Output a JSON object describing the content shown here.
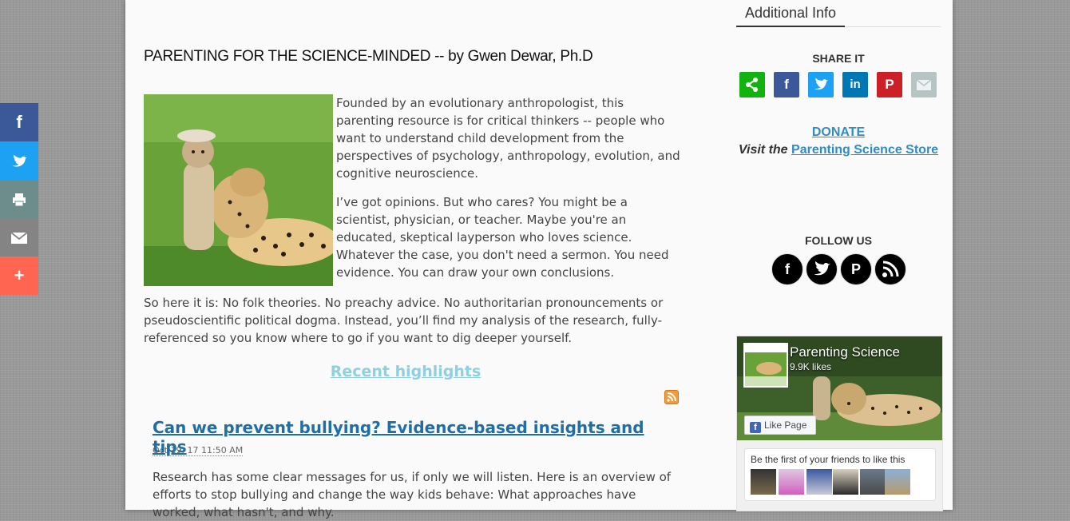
{
  "article": {
    "heading": "PARENTING FOR THE SCIENCE-MINDED -- by Gwen Dewar, Ph.D",
    "intro_p1": "Founded by an evolutionary anthropologist, this parenting resource is for critical thinkers -- people who want to understand child development from the perspectives of psychology, anthropology, evolution, and cognitive neuroscience.",
    "intro_p2": "I’ve got opinions. But who cares? You might be a scientist, physician, or teacher. Maybe you're an educated, skeptical layperson who loves science. Whatever the case, you don't need a sermon. You need evidence. You can draw your own conclusions.",
    "intro_p3": "So here it is: No folk theories. No preachy advice. No authoritarian pronouncements or pseudoscientific political dogma. Instead, you’ll find my analysis of the research, fully-referenced so you know where to go if you want to dig deeper yourself.",
    "recent_label": "Recent highlights"
  },
  "post": {
    "title": "Can we prevent bullying? Evidence-based insights and tips",
    "date": "Oct 19, 17 11:50 AM",
    "excerpt": "Research has some clear messages for us, if only we will listen. Here is an overview of efforts to stop bullying and change the way kids behave: What approaches have worked, what hasn't, and why."
  },
  "sidebar": {
    "tab_label": "Additional Info",
    "share_title": "SHARE IT",
    "share_buttons": [
      {
        "icon": "share-icon",
        "color": "#11b311"
      },
      {
        "icon": "facebook-icon",
        "color": "#3b5998"
      },
      {
        "icon": "twitter-icon",
        "color": "#1da1f2"
      },
      {
        "icon": "linkedin-icon",
        "color": "#0077b5"
      },
      {
        "icon": "pinterest-icon",
        "color": "#cb2027"
      },
      {
        "icon": "email-icon",
        "color": "#b7c4c4"
      }
    ],
    "donate_label": "DONATE",
    "visit_label": "Visit the",
    "store_label": "Parenting Science Store",
    "follow_title": "FOLLOW US",
    "follow_icons": [
      "facebook-icon",
      "twitter-icon",
      "pinterest-icon",
      "rss-icon"
    ]
  },
  "fb_widget": {
    "page_name": "Parenting Science",
    "likes": "9.9K likes",
    "like_button": "Like Page",
    "friends_text": "Be the first of your friends to like this"
  },
  "share_bar": [
    {
      "icon": "facebook-icon",
      "color": "#3b5998"
    },
    {
      "icon": "twitter-icon",
      "color": "#1da1f2"
    },
    {
      "icon": "print-icon",
      "color": "#6d8c8c"
    },
    {
      "icon": "email-icon",
      "color": "#848484"
    },
    {
      "icon": "plus-icon",
      "color": "#ff6550"
    }
  ]
}
